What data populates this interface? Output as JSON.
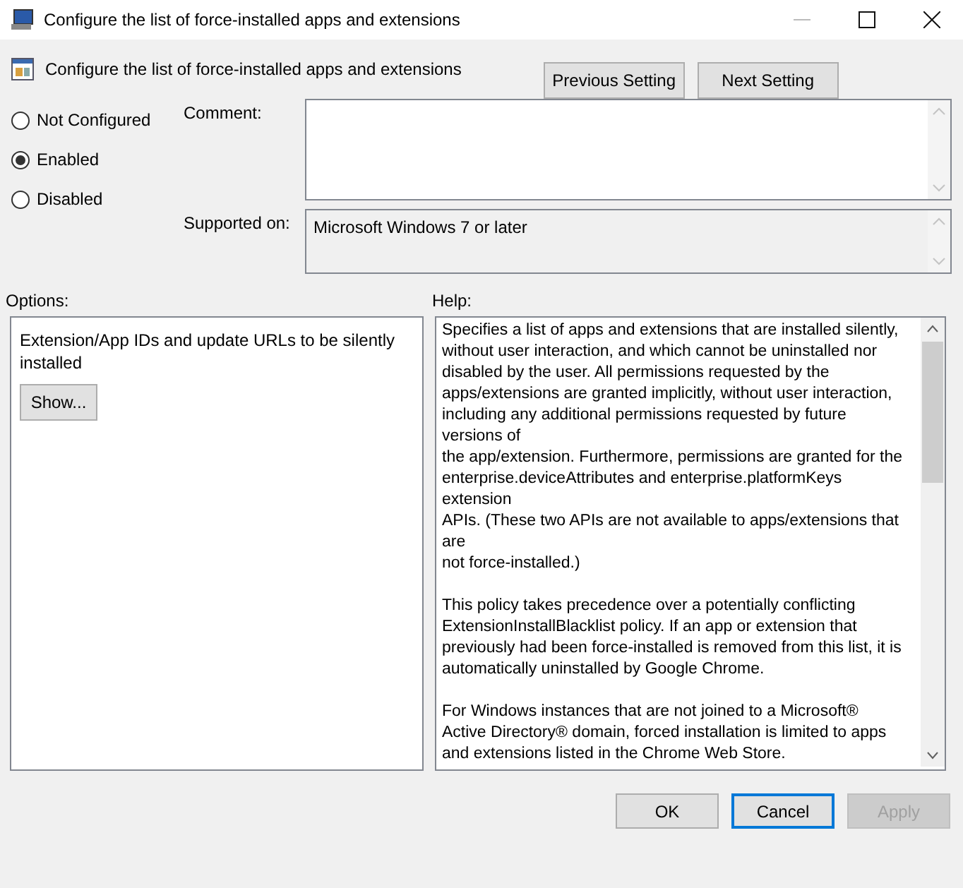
{
  "window": {
    "title": "Configure the list of force-installed apps and extensions"
  },
  "header": {
    "title": "Configure the list of force-installed apps and extensions",
    "nav_buttons": [
      {
        "label": "Previous Setting"
      },
      {
        "label": "Next Setting"
      }
    ]
  },
  "state_options": [
    {
      "label": "Not Configured",
      "selected": false
    },
    {
      "label": "Enabled",
      "selected": true
    },
    {
      "label": "Disabled",
      "selected": false
    }
  ],
  "comment": {
    "label": "Comment:"
  },
  "supported_on": {
    "label": "Supported on:",
    "value": "Microsoft Windows 7 or later"
  },
  "options": {
    "label": "Options:",
    "description": "Extension/App IDs and update URLs to be silently installed",
    "button": "Show..."
  },
  "help": {
    "label": "Help:",
    "paragraphs": [
      [
        "Specifies a list of apps and extensions that are installed silently,",
        "without user interaction, and which cannot be uninstalled nor",
        "disabled by the user. All permissions requested by the",
        "apps/extensions are granted implicitly, without user interaction,",
        "including any additional permissions requested by future",
        "versions of",
        "the app/extension. Furthermore, permissions are granted for the",
        "enterprise.deviceAttributes and enterprise.platformKeys",
        "extension",
        "APIs. (These two APIs are not available to apps/extensions that",
        "are",
        "not force-installed.)"
      ],
      [
        "This policy takes precedence over a potentially conflicting",
        "ExtensionInstallBlacklist policy. If an app or extension that",
        "previously had been force-installed is removed from this list, it is",
        "automatically uninstalled by Google Chrome."
      ],
      [
        "For Windows instances that are not joined to a Microsoft®",
        "Active Directory® domain, forced installation is limited to apps",
        "and extensions listed in the Chrome Web Store."
      ]
    ]
  },
  "buttons": [
    {
      "label": "OK",
      "focused": false,
      "disabled": false
    },
    {
      "label": "Cancel",
      "focused": true,
      "disabled": false
    },
    {
      "label": "Apply",
      "focused": false,
      "disabled": true
    }
  ]
}
